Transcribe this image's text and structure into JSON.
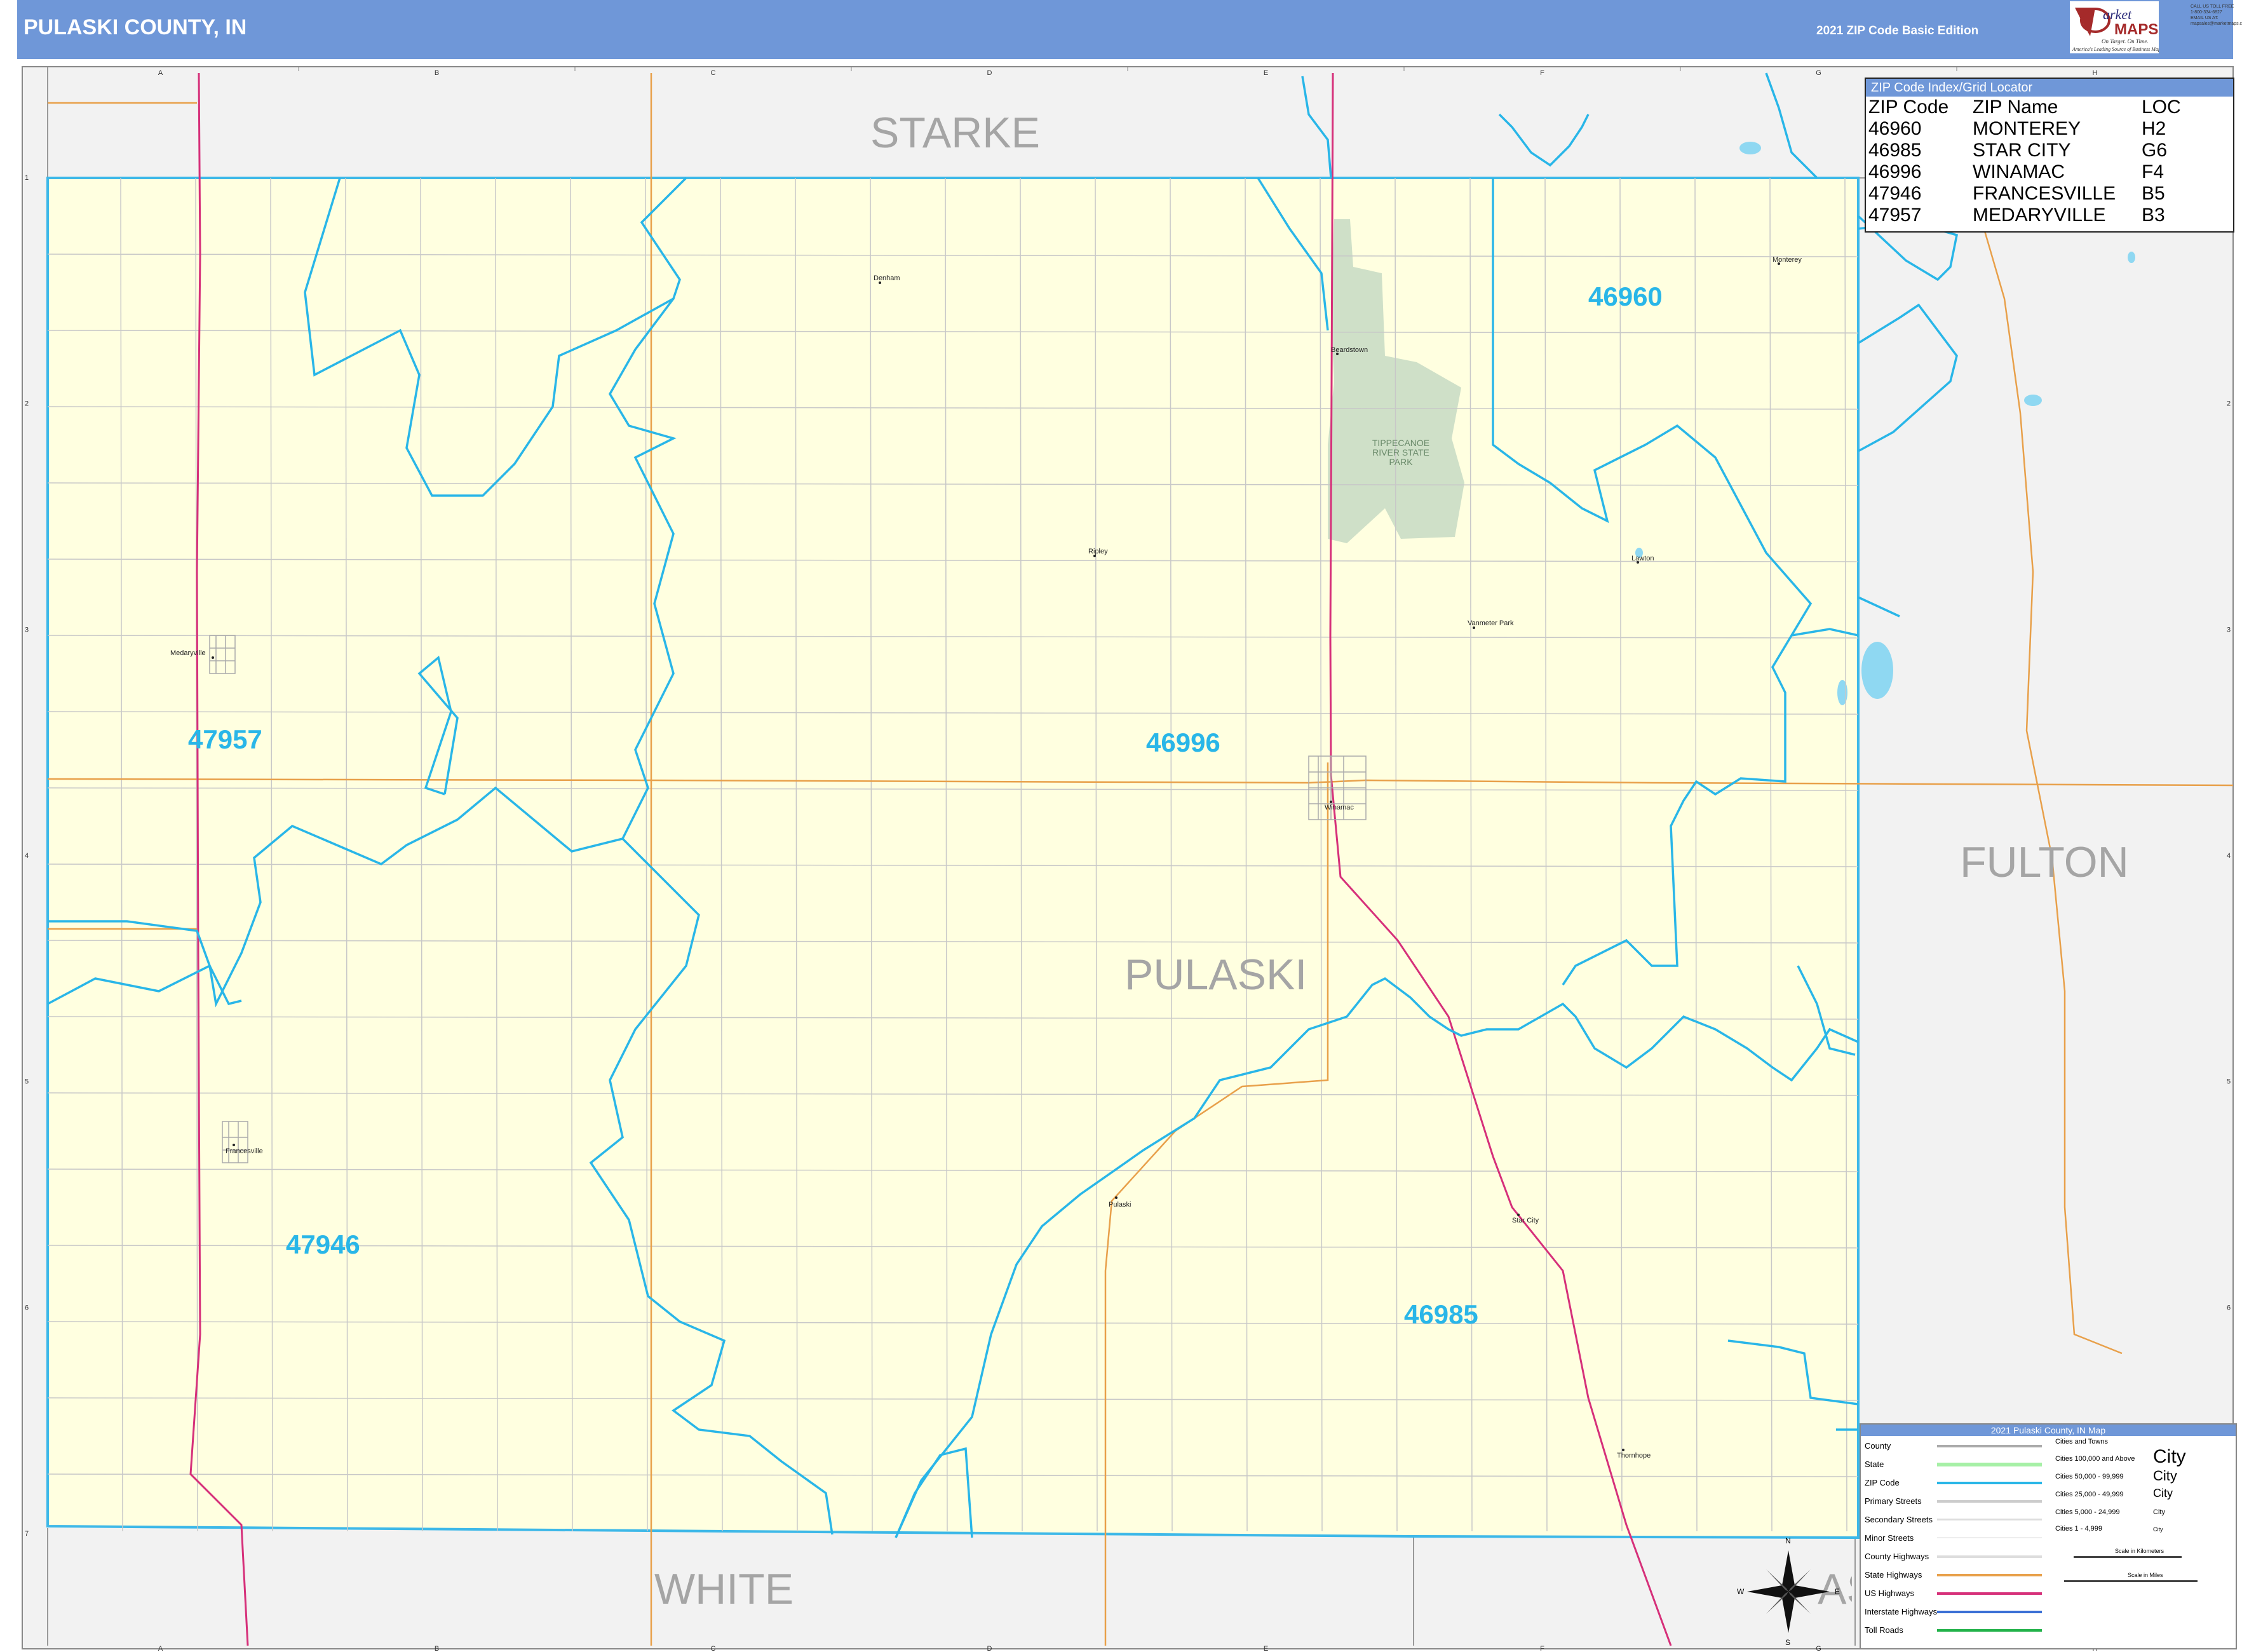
{
  "header": {
    "title": "PULASKI COUNTY, IN",
    "edition": "2021 ZIP Code Basic Edition",
    "logo_text": "MarketMAPS",
    "logo_tagline": "On Target. On Time. America's Leading Source of Business Maps",
    "logo_contact": "CALL US TOLL FREE 1-800-334-6827 EMAIL US AT: mapsales@marketmaps.com"
  },
  "grid": {
    "columns": [
      "A",
      "B",
      "C",
      "D",
      "E",
      "F",
      "G",
      "H"
    ],
    "rows": [
      "1",
      "2",
      "3",
      "4",
      "5",
      "6",
      "7"
    ]
  },
  "counties": {
    "main": "PULASKI",
    "neighbors": [
      "STARKE",
      "FULTON",
      "WHITE",
      "CASS"
    ]
  },
  "zip_codes": [
    "46960",
    "46996",
    "47957",
    "47946",
    "46985"
  ],
  "places": [
    "Denham",
    "Beardstown",
    "Monterey",
    "Lawton",
    "Ripley",
    "Medaryville",
    "Vanmeter Park",
    "Winamac",
    "Francesville",
    "Pulaski",
    "Star City",
    "Thornhope"
  ],
  "park": "TIPPECANOE RIVER STATE PARK",
  "zip_index": {
    "title": "ZIP Code Index/Grid Locator",
    "headers": [
      "ZIP Code",
      "ZIP Name",
      "LOC"
    ],
    "rows": [
      [
        "46960",
        "MONTEREY",
        "H2"
      ],
      [
        "46985",
        "STAR CITY",
        "G6"
      ],
      [
        "46996",
        "WINAMAC",
        "F4"
      ],
      [
        "47946",
        "FRANCESVILLE",
        "B5"
      ],
      [
        "47957",
        "MEDARYVILLE",
        "B3"
      ]
    ]
  },
  "legend": {
    "title": "2021 Pulaski County, IN Map",
    "items": [
      "County",
      "State",
      "ZIP Code",
      "Primary Streets",
      "Secondary Streets",
      "Minor Streets",
      "County Highways",
      "State Highways",
      "US Highways",
      "Interstate Highways",
      "Toll Roads"
    ],
    "cities_title": "Cities and Towns",
    "cities": [
      {
        "label": "Cities 100,000 and Above",
        "sample": "City"
      },
      {
        "label": "Cities 50,000 - 99,999",
        "sample": "City"
      },
      {
        "label": "Cities 25,000 - 49,999",
        "sample": "City"
      },
      {
        "label": "Cities 5,000 - 24,999",
        "sample": "City"
      },
      {
        "label": "Cities 1 - 4,999",
        "sample": "City"
      }
    ],
    "scale_km": "Scale in Kilometers",
    "scale_mi": "Scale in Miles"
  },
  "compass": {
    "n": "N",
    "s": "S",
    "e": "E",
    "w": "W"
  },
  "colors": {
    "header": "#6f97d8",
    "county_fill": "#ffffe0",
    "outside_fill": "#f2f2f2",
    "zip_boundary": "#29b6e8",
    "zip_label": "#29b6e8",
    "us_highway": "#d6307a",
    "state_highway": "#e8a04a",
    "park": "#cfe0c8",
    "water": "#8fd8f2"
  }
}
